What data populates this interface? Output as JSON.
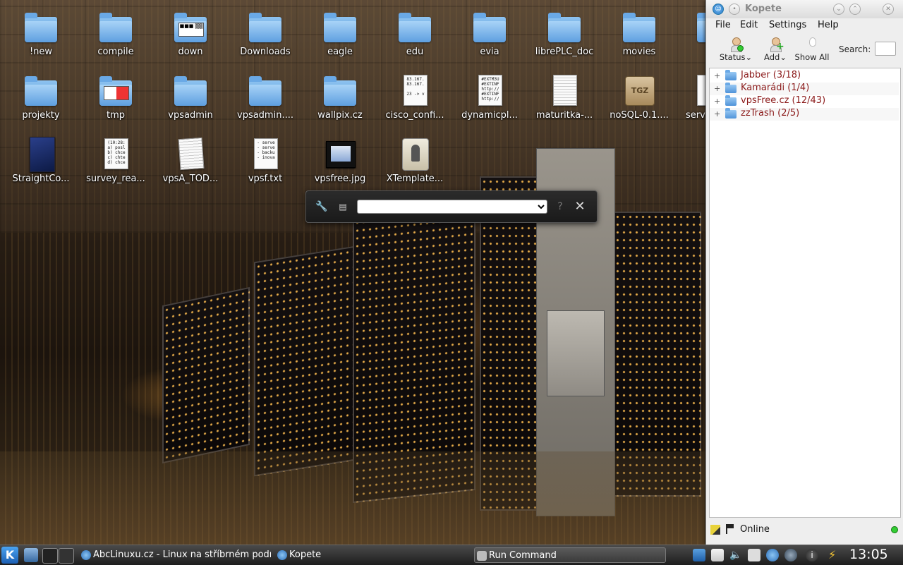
{
  "desktop": {
    "icons": [
      {
        "label": "!new",
        "type": "folder"
      },
      {
        "label": "compile",
        "type": "folder"
      },
      {
        "label": "down",
        "type": "folder"
      },
      {
        "label": "Downloads",
        "type": "folder"
      },
      {
        "label": "eagle",
        "type": "folder"
      },
      {
        "label": "edu",
        "type": "folder"
      },
      {
        "label": "evia",
        "type": "folder"
      },
      {
        "label": "librePLC_doc",
        "type": "folder"
      },
      {
        "label": "movies",
        "type": "folder"
      },
      {
        "label": "projekty",
        "type": "folder"
      },
      {
        "label": "tmp",
        "type": "folder"
      },
      {
        "label": "vpsadmin",
        "type": "folder"
      },
      {
        "label": "vpsadmin....",
        "type": "folder"
      },
      {
        "label": "wallpix.cz",
        "type": "folder"
      },
      {
        "label": "cisco_confi...",
        "type": "text-file"
      },
      {
        "label": "dynamicpl...",
        "type": "text-file"
      },
      {
        "label": "maturitka-...",
        "type": "document-file"
      },
      {
        "label": "noSQL-0.1....",
        "type": "archive-file"
      },
      {
        "label": "serv",
        "type": "text-file"
      },
      {
        "label": "StraightCo...",
        "type": "book-file"
      },
      {
        "label": "survey_rea...",
        "type": "text-file"
      },
      {
        "label": "vpsA_TOD...",
        "type": "text-file"
      },
      {
        "label": "vpsf.txt",
        "type": "text-file"
      },
      {
        "label": "vpsfree.jpg",
        "type": "image-file"
      },
      {
        "label": "XTemplate...",
        "type": "package-file"
      }
    ],
    "thumb_text": {
      "down": "■■■ ▒▒",
      "cisco": "83.167.\n83.167.\n\n23 -> v",
      "dynamic": "#EXTM3U\n#EXTINF\nhttp://\n#EXTINF\nhttp://",
      "survey": "(10:28:\na) posl\nb) chce\nc) chte\nd) chce",
      "vpsf": "- serve\n- serve\n- backu\n- inova",
      "tgz": "TGZ"
    }
  },
  "runner": {
    "query_value": ""
  },
  "kopete": {
    "title": "Kopete",
    "menu": [
      "File",
      "Edit",
      "Settings",
      "Help"
    ],
    "toolbar": {
      "status": "Status",
      "add": "Add",
      "show_all": "Show All",
      "search_label": "Search:",
      "search_value": ""
    },
    "groups": [
      {
        "label": "Jabber (3/18)"
      },
      {
        "label": "Kamarádi (1/4)"
      },
      {
        "label": "vpsFree.cz (12/43)"
      },
      {
        "label": "zzTrash (2/5)"
      }
    ],
    "status_text": "Online"
  },
  "taskbar": {
    "tasks": [
      {
        "label": "AbcLinuxu.cz - Linux na stříbrném podn"
      },
      {
        "label": "Kopete"
      },
      {
        "label": "Run Command"
      }
    ],
    "clock": "13:05"
  },
  "colors": {
    "group_text": "#8b1a1a",
    "folder_blue": "#4f93d9",
    "taskbar": "#1e1e1e"
  }
}
